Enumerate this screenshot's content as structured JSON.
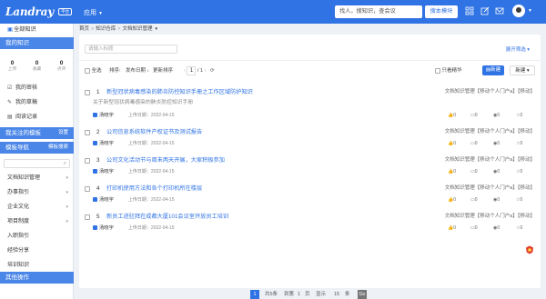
{
  "header": {
    "logo": "Landray",
    "logo_badge": "平台",
    "app_menu": "应用",
    "search_placeholder": "找人，搜知识，查会议",
    "search_button": "搜本模块"
  },
  "sidebar": {
    "all_knowledge": "全部知识",
    "my_knowledge": "我的知识",
    "stats": [
      {
        "value": "0",
        "label": "上传"
      },
      {
        "value": "0",
        "label": "收藏"
      },
      {
        "value": "0",
        "label": "点评"
      }
    ],
    "my_items": [
      "我的审核",
      "我的草稿",
      "阅读记录"
    ],
    "followed_template": "我关注的模板",
    "followed_action": "设置",
    "template_nav": "模板导航",
    "template_nav_action": "模板搜索",
    "categories": [
      "文档知识管理",
      "办事指引",
      "企业文化",
      "项目制度",
      "入职指引",
      "经验分享",
      "培训知识"
    ],
    "other_ops": "其他操作"
  },
  "breadcrumb": [
    "首页",
    "知识仓库",
    "文档知识管理"
  ],
  "filter": {
    "keyword_placeholder": "请输入标题",
    "expand": "展开筛选"
  },
  "toolbar": {
    "select_all": "全选",
    "sort_label": "排序:",
    "sort_field": "发布日期",
    "sort_order": "更新排序",
    "page_current": "1",
    "page_total": "/ 1",
    "only_essence": "只看精华",
    "new_button": "新建",
    "add_button": "新建"
  },
  "docs": [
    {
      "index": "1",
      "title": "新型冠状病毒感染的肺炎防控知识手册之工作区域防护知识",
      "summary": "关于新型冠状病毒感染的肺炎防控知识手册",
      "category": "文档知识管理【移动个人门户a】【移动】",
      "author": "汤晓宇",
      "date": "上传日期：2022-04-15",
      "likes": "0",
      "comments": "0",
      "views": "0",
      "favs": "0"
    },
    {
      "index": "2",
      "title": "公司信息系统软件产权证书及测试报告",
      "summary": "",
      "category": "文档知识管理【移动个人门户a】【移动】",
      "author": "汤晓宇",
      "date": "上传日期：2022-04-15",
      "likes": "0",
      "comments": "0",
      "views": "0",
      "favs": "0"
    },
    {
      "index": "3",
      "title": "公司文化活动节与周末两天开展，大家积极参加",
      "summary": "",
      "category": "文档知识管理【移动个人门户a】【移动】",
      "author": "汤晓宇",
      "date": "上传日期：2022-04-15",
      "likes": "0",
      "comments": "0",
      "views": "0",
      "favs": "0"
    },
    {
      "index": "4",
      "title": "打印机使用方法和各个打印机所在楼层",
      "summary": "",
      "category": "文档知识管理【移动个人门户a】【移动】",
      "author": "汤晓宇",
      "date": "上传日期：2022-04-15",
      "likes": "0",
      "comments": "0",
      "views": "0",
      "favs": "0"
    },
    {
      "index": "5",
      "title": "新员工进驻拜在成都大厦101会议室开放员工培训",
      "summary": "",
      "category": "文档知识管理【移动个人门户a】【移动】",
      "author": "汤晓宇",
      "date": "上传日期：2022-04-15",
      "likes": "0",
      "comments": "0",
      "views": "0",
      "favs": "0"
    }
  ],
  "pager": {
    "current": "1",
    "total_text": "共5条",
    "per_page": "到第",
    "page_input": "1",
    "page_unit": "页",
    "per_text": "显示",
    "per_value": "15",
    "per_unit": "条",
    "go": "Go"
  },
  "colors": {
    "primary": "#2f73e4",
    "sidebar_section": "#4a86e8"
  }
}
